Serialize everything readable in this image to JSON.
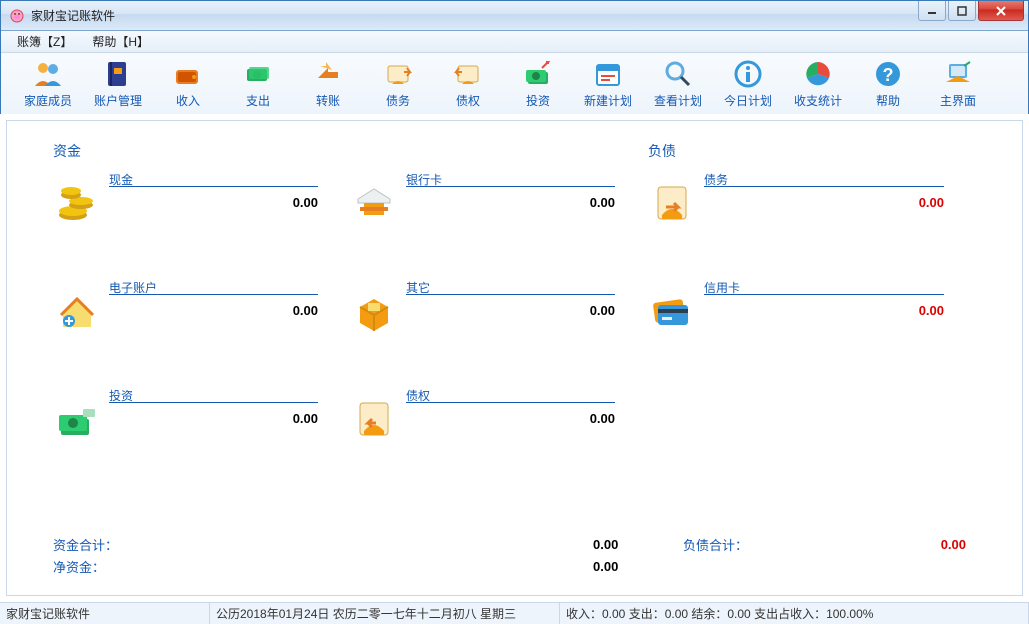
{
  "title": "家财宝记账软件",
  "menu": {
    "ledger": "账簿【Z】",
    "help": "帮助【H】"
  },
  "toolbar": [
    {
      "id": "family-members",
      "label": "家庭成员"
    },
    {
      "id": "account-manage",
      "label": "账户管理"
    },
    {
      "id": "income",
      "label": "收入"
    },
    {
      "id": "expense",
      "label": "支出"
    },
    {
      "id": "transfer",
      "label": "转账"
    },
    {
      "id": "debt",
      "label": "债务"
    },
    {
      "id": "credit",
      "label": "债权"
    },
    {
      "id": "invest",
      "label": "投资"
    },
    {
      "id": "new-plan",
      "label": "新建计划"
    },
    {
      "id": "view-plan",
      "label": "查看计划"
    },
    {
      "id": "today-plan",
      "label": "今日计划"
    },
    {
      "id": "income-expense-stats",
      "label": "收支统计"
    },
    {
      "id": "help",
      "label": "帮助"
    },
    {
      "id": "main-ui",
      "label": "主界面"
    }
  ],
  "sections": {
    "assets": "资金",
    "liabilities": "负债"
  },
  "assets": {
    "cash": {
      "label": "现金",
      "value": "0.00"
    },
    "bankcard": {
      "label": "银行卡",
      "value": "0.00"
    },
    "eaccount": {
      "label": "电子账户",
      "value": "0.00"
    },
    "other": {
      "label": "其它",
      "value": "0.00"
    },
    "invest": {
      "label": "投资",
      "value": "0.00"
    },
    "credit": {
      "label": "债权",
      "value": "0.00"
    }
  },
  "liabilities": {
    "debt": {
      "label": "债务",
      "value": "0.00"
    },
    "creditcard": {
      "label": "信用卡",
      "value": "0.00"
    }
  },
  "totals": {
    "assets_label": "资金合计：",
    "assets_value": "0.00",
    "liab_label": "负债合计：",
    "liab_value": "0.00",
    "net_label": "净资金：",
    "net_value": "0.00"
  },
  "status": {
    "app": "家财宝记账软件",
    "date": "公历2018年01月24日 农历二零一七年十二月初八 星期三",
    "summary": "收入：0.00 支出：0.00 结余：0.00 支出占收入：100.00%"
  }
}
